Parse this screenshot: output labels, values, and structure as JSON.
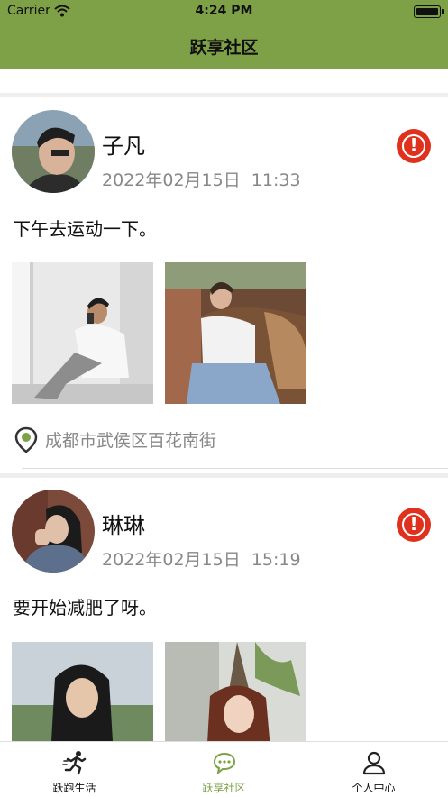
{
  "status_bar": {
    "carrier": "Carrier",
    "time": "4:24 PM"
  },
  "header": {
    "title": "跃享社区"
  },
  "posts": [
    {
      "name": "子凡",
      "time": "2022年02月15日  11:33",
      "content": "下午去运动一下。",
      "location": "成都市武侯区百花南街"
    },
    {
      "name": "琳琳",
      "time": "2022年02月15日  15:19",
      "content": "要开始减肥了呀。"
    }
  ],
  "tabs": [
    {
      "label": "跃跑生活",
      "icon": "running-icon"
    },
    {
      "label": "跃享社区",
      "icon": "chat-icon"
    },
    {
      "label": "个人中心",
      "icon": "person-icon"
    }
  ],
  "colors": {
    "brand": "#7ea047",
    "report": "#e0311e",
    "muted": "#888888"
  }
}
